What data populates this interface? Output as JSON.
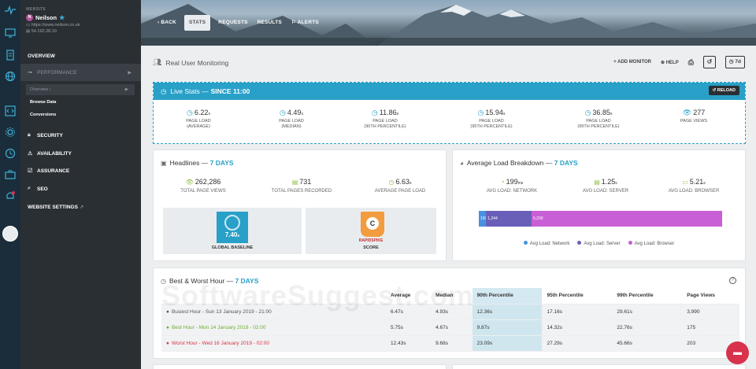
{
  "site": {
    "label": "WEBSITE",
    "badge": "N",
    "name": "Neilson",
    "url": "https://www.neilson.co.uk",
    "ip": "54.192.28.10"
  },
  "sidebar": {
    "overview": "OVERVIEW",
    "performance": "PERFORMANCE",
    "sub_overview": "Overview",
    "browse_data": "Browse Data",
    "conversions": "Conversions",
    "security": "SECURITY",
    "availability": "AVAILABILITY",
    "assurance": "ASSURANCE",
    "seo": "SEO",
    "website_settings": "WEBSITE SETTINGS"
  },
  "topnav": {
    "back": "BACK",
    "stats": "STATS",
    "requests": "REQUESTS",
    "results": "RESULTS",
    "alerts": "ALERTS"
  },
  "page": {
    "title": "Real User Monitoring",
    "add_monitor": "ADD MONITOR",
    "help": "HELP",
    "range": "7d"
  },
  "live": {
    "title": "Live Stats —",
    "since": "SINCE 11:00",
    "reload": "RELOAD",
    "stats": [
      {
        "value": "6.22",
        "unit": "s",
        "cap1": "PAGE LOAD",
        "cap2": "(AVERAGE)"
      },
      {
        "value": "4.49",
        "unit": "s",
        "cap1": "PAGE LOAD",
        "cap2": "(MEDIAN)"
      },
      {
        "value": "11.86",
        "unit": "s",
        "cap1": "PAGE LOAD",
        "cap2": "(90TH PERCENTILE)"
      },
      {
        "value": "15.94",
        "unit": "s",
        "cap1": "PAGE LOAD",
        "cap2": "(95TH PERCENTILE)"
      },
      {
        "value": "36.85",
        "unit": "s",
        "cap1": "PAGE LOAD",
        "cap2": "(99TH PERCENTILE)"
      },
      {
        "value": "277",
        "unit": "",
        "cap1": "PAGE VIEWS",
        "cap2": ""
      }
    ]
  },
  "headlines": {
    "title": "Headlines —",
    "range": "7 DAYS",
    "metrics": [
      {
        "value": "262,286",
        "caption": "TOTAL PAGE VIEWS"
      },
      {
        "value": "731",
        "caption": "TOTAL PAGES RECORDED"
      },
      {
        "value": "6.63",
        "unit": "s",
        "caption": "AVERAGE PAGE LOAD"
      }
    ],
    "baseline_value": "7.40",
    "baseline_unit": "s",
    "baseline_label": "GLOBAL BASELINE",
    "score_grade": "C",
    "score_brand": "RAPIDSPIKE",
    "score_label": "SCORE"
  },
  "breakdown": {
    "title": "Average Load Breakdown —",
    "range": "7 DAYS",
    "metrics": [
      {
        "value": "199",
        "unit": "ms",
        "caption": "AVG LOAD: NETWORK"
      },
      {
        "value": "1.25",
        "unit": "s",
        "caption": "AVG LOAD: SERVER"
      },
      {
        "value": "5.21",
        "unit": "s",
        "caption": "AVG LOAD: BROWSER"
      }
    ],
    "bar_labels": [
      "199",
      "1,244",
      "5,209"
    ],
    "legend": [
      "Avg Load: Network",
      "Avg Load: Server",
      "Avg Load: Browser"
    ],
    "colors": {
      "network": "#4a90e2",
      "server": "#6a5fb8",
      "browser": "#c85fd6"
    }
  },
  "chart_data": {
    "type": "bar",
    "categories": [
      "Avg Load: Network",
      "Avg Load: Server",
      "Avg Load: Browser"
    ],
    "values": [
      199,
      1244,
      5209
    ],
    "stacked": true
  },
  "best_worst": {
    "title": "Best & Worst Hour —",
    "range": "7 DAYS",
    "headers": [
      "",
      "Average",
      "Median",
      "90th Percentile",
      "95th Percentile",
      "99th Percentile",
      "Page Views"
    ],
    "rows": [
      {
        "label": "Busiest Hour - Sun 13 January 2019 - 21:00",
        "cells": [
          "6.47s",
          "4.93s",
          "12.36s",
          "17.16s",
          "29.61s",
          "3,990"
        ]
      },
      {
        "label": "Best Hour - Mon 14 January 2019 - 02:00",
        "cells": [
          "5.75s",
          "4.67s",
          "9.87s",
          "14.32s",
          "22.76s",
          "175"
        ]
      },
      {
        "label": "Worst Hour - Wed 16 January 2019 - 02:00",
        "cells": [
          "12.43s",
          "9.68s",
          "23.09s",
          "27.29s",
          "45.66s",
          "203"
        ]
      }
    ]
  },
  "watermark": "SoftwareSuggest.com"
}
